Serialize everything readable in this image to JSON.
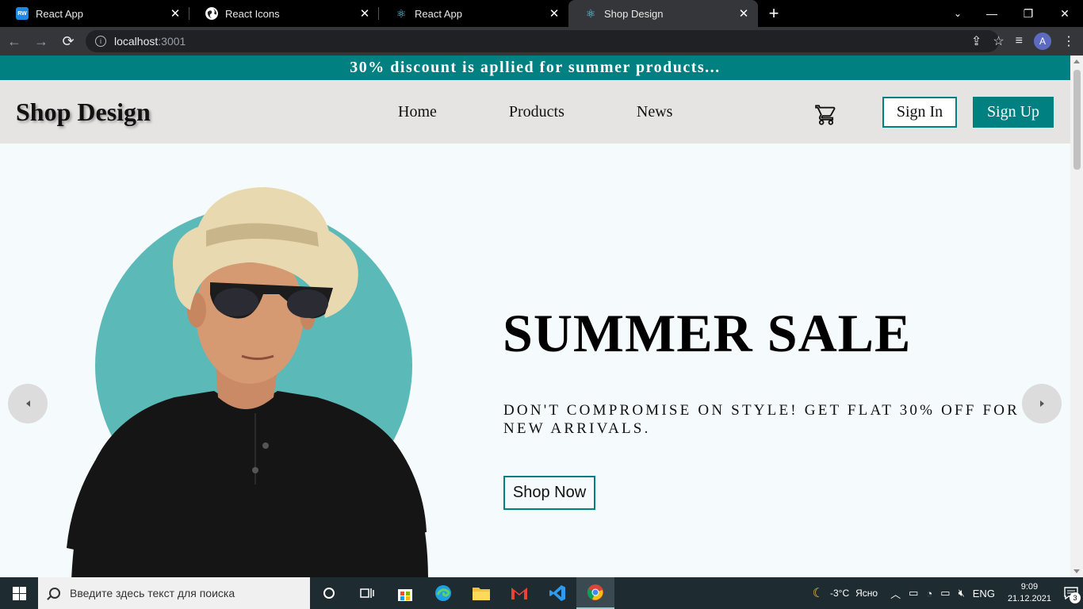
{
  "browser": {
    "tabs": [
      {
        "title": "React App",
        "icon": "reactwind-icon"
      },
      {
        "title": "React Icons",
        "icon": "globe-icon"
      },
      {
        "title": "React App",
        "icon": "react-icon"
      },
      {
        "title": "Shop Design",
        "icon": "react-icon",
        "active": true
      }
    ],
    "url_host": "localhost",
    "url_port": ":3001",
    "profile_initial": "A"
  },
  "page": {
    "announcement": "30% discount is apllied for summer products...",
    "logo": "Shop Design",
    "nav": {
      "home": "Home",
      "products": "Products",
      "news": "News"
    },
    "signin": "Sign In",
    "signup": "Sign Up",
    "hero": {
      "title": "SUMMER SALE",
      "description": "DON'T COMPROMISE ON STYLE! GET FLAT 30% OFF FOR NEW ARRIVALS.",
      "cta": "Shop Now"
    },
    "colors": {
      "accent": "#008080",
      "navbar_bg": "#e6e3e3",
      "hero_circle": "#5bb9b8",
      "page_bg": "#f5fafd"
    }
  },
  "taskbar": {
    "search_placeholder": "Введите здесь текст для поиска",
    "weather_temp": "-3°C",
    "weather_text": "Ясно",
    "lang": "ENG",
    "time": "9:09",
    "date": "21.12.2021",
    "notifications": "3"
  }
}
